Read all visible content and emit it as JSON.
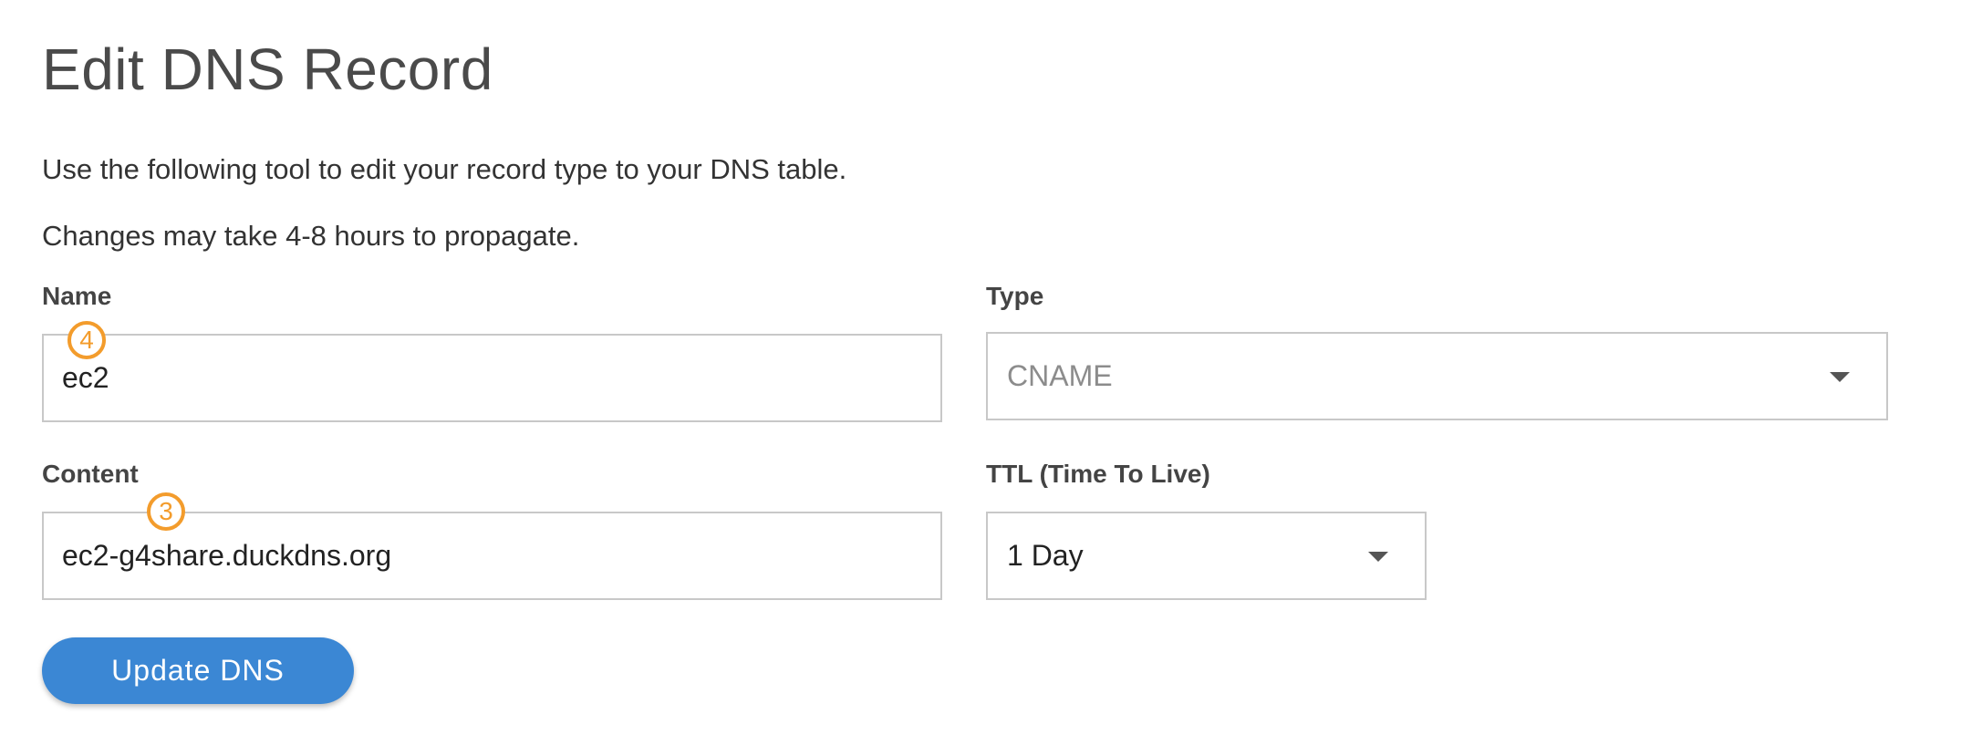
{
  "page": {
    "title": "Edit DNS Record",
    "intro_line_1": "Use the following tool to edit your record type to your DNS table.",
    "intro_line_2": "Changes may take 4-8 hours to propagate."
  },
  "form": {
    "name": {
      "label": "Name",
      "value": "ec2",
      "badge": "4"
    },
    "type": {
      "label": "Type",
      "selected": "CNAME"
    },
    "content": {
      "label": "Content",
      "value": "ec2-g4share.duckdns.org",
      "badge": "3"
    },
    "ttl": {
      "label": "TTL (Time To Live)",
      "selected": "1 Day"
    }
  },
  "actions": {
    "submit_label": "Update DNS"
  },
  "colors": {
    "accent": "#3b87d4",
    "badge": "#f39c2c",
    "border": "#c8c8c8"
  },
  "icons": {
    "dropdown": "caret-down-icon"
  }
}
